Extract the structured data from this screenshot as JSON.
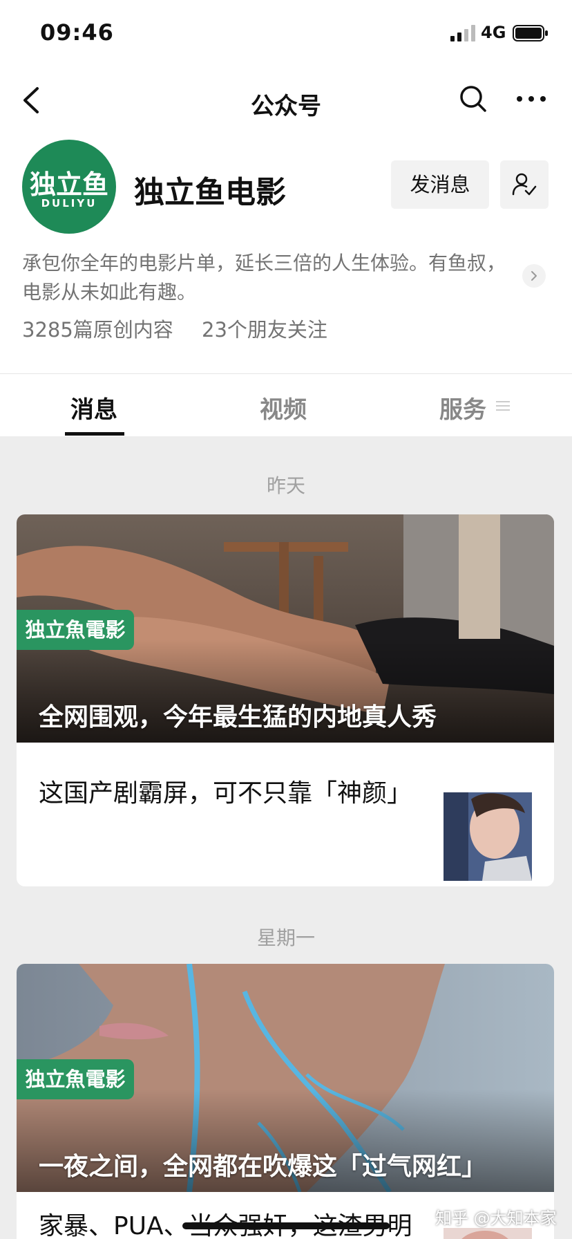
{
  "status_bar": {
    "time": "09:46",
    "network": "4G"
  },
  "nav": {
    "title": "公众号"
  },
  "account": {
    "avatar_cn": "独立鱼",
    "avatar_en": "DULIYU",
    "name": "独立鱼电影",
    "message_button": "发消息",
    "bio": "承包你全年的电影片单，延长三倍的人生体验。有鱼叔，电影从未如此有趣。",
    "original_count": "3285篇原创内容",
    "friends_following": "23个朋友关注"
  },
  "tabs": [
    {
      "label": "消息",
      "active": true
    },
    {
      "label": "视频",
      "active": false
    },
    {
      "label": "服务",
      "active": false
    }
  ],
  "feed": [
    {
      "date": "昨天",
      "brand_tag": "独立魚電影",
      "cover_title": "全网围观，今年最生猛的内地真人秀",
      "item_title": "这国产剧霸屏，可不只靠「神颜」"
    },
    {
      "date": "星期一",
      "brand_tag": "独立魚電影",
      "cover_title": "一夜之间，全网都在吹爆这「过气网红」",
      "item_title": "家暴、PUA、当众强奸，这渣男明"
    }
  ],
  "watermark": "知乎 @大知本家",
  "colors": {
    "brand_green": "#1e8a57",
    "tag_green": "#2a9560",
    "feed_bg": "#ededed"
  }
}
